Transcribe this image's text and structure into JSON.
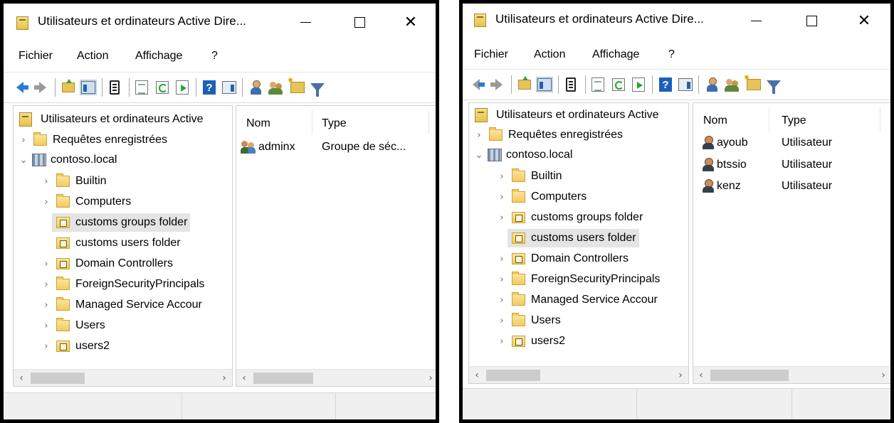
{
  "window_title": "Utilisateurs et ordinateurs Active Dire...",
  "menu": [
    "Fichier",
    "Action",
    "Affichage",
    "?"
  ],
  "columns": {
    "name": "Nom",
    "type": "Type"
  },
  "tree": {
    "root": "Utilisateurs et ordinateurs Active",
    "saved_queries": "Requêtes enregistrées",
    "domain": "contoso.local",
    "children": [
      "Builtin",
      "Computers",
      "customs groups folder",
      "customs users folder",
      "Domain Controllers",
      "ForeignSecurityPrincipals",
      "Managed Service Accour",
      "Users",
      "users2"
    ]
  },
  "left_window": {
    "selected_node": "customs groups folder",
    "items": [
      {
        "name": "adminx",
        "type": "Groupe de séc...",
        "icon": "group-icon"
      }
    ]
  },
  "right_window": {
    "selected_node": "customs users folder",
    "items": [
      {
        "name": "ayoub",
        "type": "Utilisateur",
        "icon": "user-icon"
      },
      {
        "name": "btssio",
        "type": "Utilisateur",
        "icon": "user-icon"
      },
      {
        "name": "kenz",
        "type": "Utilisateur",
        "icon": "user-icon"
      }
    ]
  },
  "colors": {
    "selection": "#e4e4e4",
    "border": "#000000",
    "statusbar": "#f0f0f0"
  }
}
